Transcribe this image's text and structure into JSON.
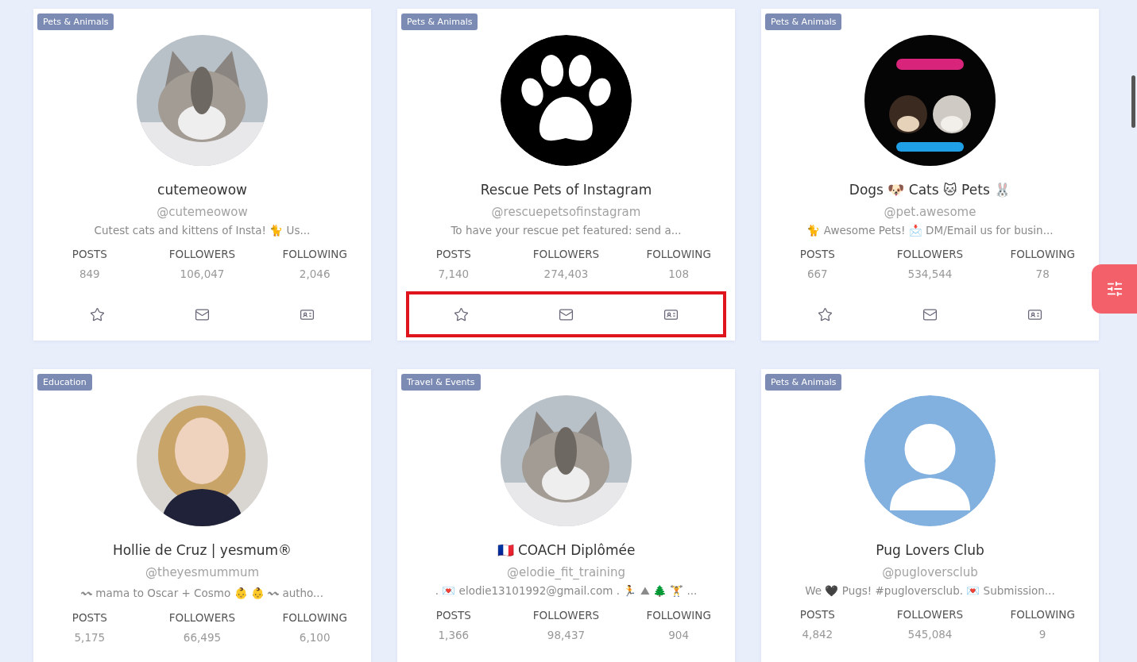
{
  "cards": [
    {
      "category": "Pets & Animals",
      "name": "cutemeowow",
      "handle": "@cutemeowow",
      "bio": "Cutest cats and kittens of Insta! 🐈 Us...",
      "stats": [
        {
          "label": "POSTS",
          "value": "849"
        },
        {
          "label": "FOLLOWERS",
          "value": "106,047"
        },
        {
          "label": "FOLLOWING",
          "value": "2,046"
        }
      ],
      "highlighted": false
    },
    {
      "category": "Pets & Animals",
      "avatar": {
        "kind": "paw"
      },
      "name": "Rescue Pets of Instagram",
      "handle": "@rescuepetsofinstagram",
      "bio": "To have your rescue pet featured: send a...",
      "stats": [
        {
          "label": "POSTS",
          "value": "7,140"
        },
        {
          "label": "FOLLOWERS",
          "value": "274,403"
        },
        {
          "label": "FOLLOWING",
          "value": "108"
        }
      ],
      "highlighted": true
    },
    {
      "category": "Pets & Animals",
      "name": "Dogs 🐶  Cats 🐱 Pets 🐰",
      "handle": "@pet.awesome",
      "bio": "🐈  Awesome Pets! 📩 DM/Email us for busin...",
      "stats": [
        {
          "label": "POSTS",
          "value": "667"
        },
        {
          "label": "FOLLOWERS",
          "value": "534,544"
        },
        {
          "label": "FOLLOWING",
          "value": "78"
        }
      ],
      "highlighted": false
    },
    {
      "category": "Education",
      "name": "Hollie de Cruz | yesmum®",
      "handle": "@theyesmummum",
      "bio": "〰 mama to Oscar + Cosmo 👶 👶  〰 autho...",
      "stats": [
        {
          "label": "POSTS",
          "value": "5,175"
        },
        {
          "label": "FOLLOWERS",
          "value": "66,495"
        },
        {
          "label": "FOLLOWING",
          "value": "6,100"
        }
      ]
    },
    {
      "category": "Travel & Events",
      "name": "🇫🇷 COACH Diplômée",
      "handle": "@elodie_fit_training",
      "bio": ". 💌 elodie13101992@gmail.com . 🏃 ⛰ 🌲 🏋 ...",
      "stats": [
        {
          "label": "POSTS",
          "value": "1,366"
        },
        {
          "label": "FOLLOWERS",
          "value": "98,437"
        },
        {
          "label": "FOLLOWING",
          "value": "904"
        }
      ]
    },
    {
      "category": "Pets & Animals",
      "avatar": {
        "kind": "silhouette"
      },
      "name": "Pug Lovers Club",
      "handle": "@pugloversclub",
      "bio": "We 🖤 Pugs! #pugloversclub. 💌 Submission...",
      "stats": [
        {
          "label": "POSTS",
          "value": "4,842"
        },
        {
          "label": "FOLLOWERS",
          "value": "545,084"
        },
        {
          "label": "FOLLOWING",
          "value": "9"
        }
      ]
    }
  ]
}
